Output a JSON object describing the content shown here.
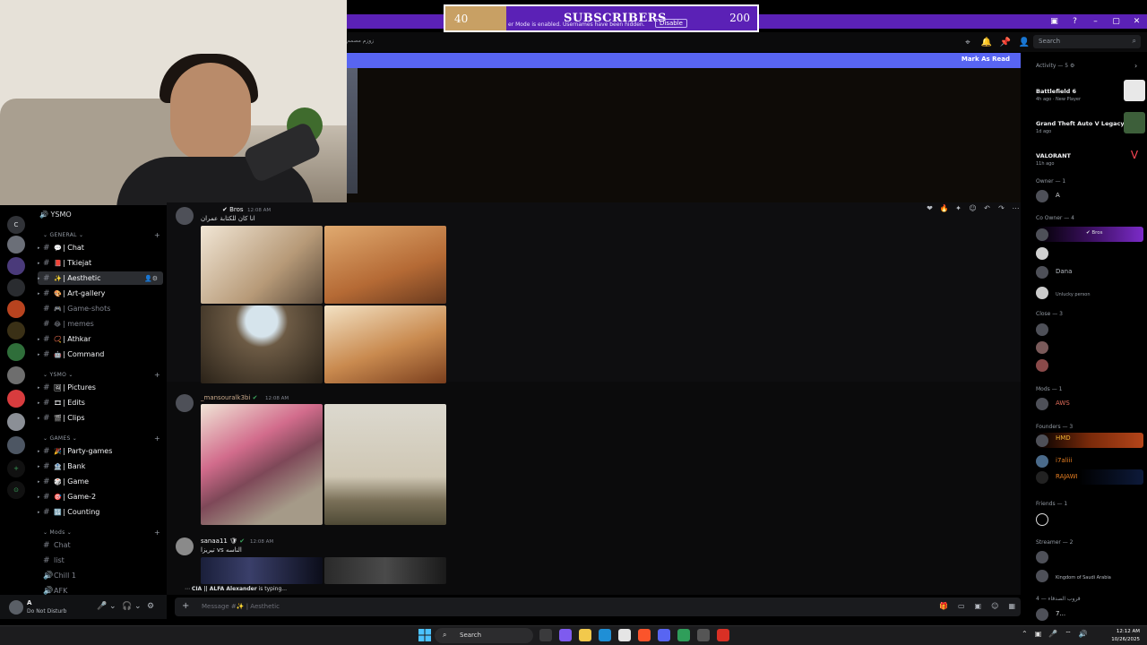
{
  "overlay": {
    "current": "40",
    "label": "SUBSCRIBERS",
    "goal": "200",
    "notice": "er Mode is enabled. Usernames have been hidden.",
    "disable": "Disable",
    "channel_top": "YSMO"
  },
  "header": {
    "crumb": "زوزم مصمم",
    "search_placeholder": "Search",
    "mark_as_read": "Mark As Read"
  },
  "server": {
    "name": "YSMO"
  },
  "rail": [
    "C",
    "",
    "",
    "",
    "",
    "",
    "",
    "",
    "",
    "",
    "",
    "",
    ""
  ],
  "categories": {
    "general": "GENERAL",
    "ysmo": "YSMO",
    "games": "GAMES",
    "mods": "Mods"
  },
  "channels_general": [
    {
      "emoji": "💬",
      "label": "| Chat"
    },
    {
      "emoji": "📕",
      "label": "| Tkiejat"
    },
    {
      "emoji": "✨",
      "label": "| Aesthetic"
    },
    {
      "emoji": "🎨",
      "label": "| Art-gallery"
    },
    {
      "emoji": "🎮",
      "label": "| Game-shots"
    },
    {
      "emoji": "😂",
      "label": "| memes"
    },
    {
      "emoji": "📿",
      "label": "| Athkar"
    },
    {
      "emoji": "🤖",
      "label": "| Command"
    }
  ],
  "channels_ysmo": [
    {
      "emoji": "🖼",
      "label": "| Pictures"
    },
    {
      "emoji": "🎞",
      "label": "| Edits"
    },
    {
      "emoji": "🎬",
      "label": "| Clips"
    }
  ],
  "channels_games": [
    {
      "emoji": "🎉",
      "label": "| Party-games"
    },
    {
      "emoji": "🏦",
      "label": "| Bank"
    },
    {
      "emoji": "🎲",
      "label": "| Game"
    },
    {
      "emoji": "🎯",
      "label": "| Game-2"
    },
    {
      "emoji": "🔢",
      "label": "| Counting"
    }
  ],
  "channels_mods": [
    "Chat",
    "list",
    "Chill 1",
    "AFK"
  ],
  "user": {
    "name": "A",
    "status": "Do Not Disturb"
  },
  "messages": [
    {
      "author": "Bros",
      "time": "12:08 AM",
      "text": "انا كان للكتابة عمران"
    },
    {
      "author": "_mansouralk3bi",
      "time": "12:08 AM",
      "text": ""
    },
    {
      "author": "sanaa11",
      "time": "12:08 AM",
      "text": "تيريزا vs الناسه"
    }
  ],
  "typing": {
    "who": "CIA || ALFA Alexander",
    "rest": "is typing..."
  },
  "composer": {
    "placeholder": "Message #✨ | Aesthetic"
  },
  "activity": {
    "title": "Activity — 5",
    "items": [
      {
        "game": "Battlefield 6",
        "sub": "4h ago · New Player"
      },
      {
        "game": "Grand Theft Auto V Legacy",
        "sub": "1d ago"
      },
      {
        "game": "VALORANT",
        "sub": "11h ago"
      }
    ]
  },
  "groups": {
    "owner": "Owner — 1",
    "coowner": "Co Owner — 4",
    "close": "Close — 3",
    "mods": "Mods — 1",
    "founders": "Founders — 3",
    "friends": "Friends — 1",
    "streamer": "Streamer — 2",
    "bottom": "4 — قروب الصدقاء"
  },
  "members": {
    "owner": "A",
    "bros": "Bros",
    "dana": "Dana",
    "unlucky": "Unlucky person",
    "aws": "AWS",
    "hmd": "HMD",
    "i7aliii": "i7aliii",
    "rajawi": "RAJAWI",
    "ksa": "Kingdom of Saudi Arabia",
    "seven": "7..."
  },
  "taskbar": {
    "search": "Search",
    "time": "12:12 AM",
    "date": "10/26/2025"
  }
}
